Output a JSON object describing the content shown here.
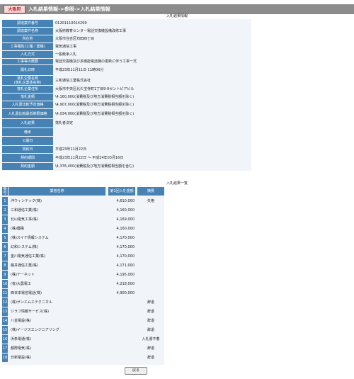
{
  "header": {
    "logo": "大阪府",
    "breadcrumb": "入札結果情報->参照->入札結果情報"
  },
  "detail": {
    "title": "入札結果情報",
    "rows": [
      {
        "label": [
          "調達案件番号"
        ],
        "value": [
          "01201110014299"
        ]
      },
      {
        "label": [
          "調達案件名称"
        ],
        "value": [
          "大阪府教育センター電話交換機設備改修工事"
        ]
      },
      {
        "label": [
          "所在地"
        ],
        "value": [
          "大阪市住吉区苅田四丁目"
        ]
      },
      {
        "label": [
          "工事種別(工種／業種)"
        ],
        "value": [
          "電気通信工事"
        ]
      },
      {
        "label": [
          "入札方式"
        ],
        "value": [
          "一般競争入札"
        ]
      },
      {
        "label": [
          "工事等の概要"
        ],
        "value": [
          "電話交換機及び多機能電話機の更新に伴う工事一式"
        ]
      },
      {
        "label": [
          "開札日時"
        ],
        "value": [
          "平成23年11月11日 11時00分"
        ]
      },
      {
        "label": [
          "落札企業名称",
          "(落札企業体名称)"
        ],
        "value": [
          "三和通信工業株式会社"
        ]
      },
      {
        "label": [
          "落札企業住所"
        ],
        "value": [
          "大阪市中央区北久宝寺町1丁目9-9セントピアビル"
        ]
      },
      {
        "label": [
          "落札金額"
        ],
        "value": [
          "\\4,160,000(消費税及び地方消費税相当額を除く)"
        ]
      },
      {
        "label": [
          "入札書比較予定価格"
        ],
        "value": [
          "\\4,907,000(消費税及び地方消費税相当額を除く)"
        ]
      },
      {
        "label": [
          "入札書比較最低制限価格"
        ],
        "value": [
          "\\4,034,000(消費税及び地方消費税相当額を除く)"
        ]
      },
      {
        "label": [
          "入札結果"
        ],
        "value": [
          "落札者決定"
        ]
      },
      {
        "label": [
          "備考"
        ],
        "value": [
          ""
        ]
      },
      {
        "label": [
          "公開日"
        ],
        "value": [
          ""
        ]
      },
      {
        "label": [
          "契約日"
        ],
        "value": [
          "平成23年11月22日"
        ]
      },
      {
        "label": [
          "契約期間"
        ],
        "value": [
          "平成23年11月22日 ～ 平成24年03月16日"
        ]
      },
      {
        "label": [
          "契約金額"
        ],
        "value": [
          "\\4,376,400(消費税及び地方消費税相当額を含む)"
        ]
      }
    ]
  },
  "bid_list": {
    "title": "入札結果一覧",
    "headers": [
      "番号",
      "業者名称",
      "第1回入札金額",
      "摘要"
    ],
    "rows": [
      {
        "no": "1",
        "name": "沖ウィンテック(株)",
        "amount": "4,610,000",
        "note": "失格"
      },
      {
        "no": "2",
        "name": "三和通信工業(株)",
        "amount": "4,160,000",
        "note": ""
      },
      {
        "no": "3",
        "name": "北山電気工事(株)",
        "amount": "4,169,000",
        "note": ""
      },
      {
        "no": "4",
        "name": "(株)優陽",
        "amount": "4,160,000",
        "note": ""
      },
      {
        "no": "5",
        "name": "(株)スイテ情報システム",
        "amount": "4,170,000",
        "note": ""
      },
      {
        "no": "6",
        "name": "幻和システム(株)",
        "amount": "4,170,000",
        "note": ""
      },
      {
        "no": "7",
        "name": "金川電気通信工業(株)",
        "amount": "4,170,000",
        "note": ""
      },
      {
        "no": "8",
        "name": "藤井通信工業(株)",
        "amount": "4,171,000",
        "note": ""
      },
      {
        "no": "9",
        "name": "(株)テーネット",
        "amount": "4,195,000",
        "note": ""
      },
      {
        "no": "10",
        "name": "(有)大農電工",
        "amount": "4,218,000",
        "note": ""
      },
      {
        "no": "11",
        "name": "西日本電信電話(株)",
        "amount": "4,900,000",
        "note": ""
      },
      {
        "no": "12",
        "name": "(株)サンエムエテクニカル",
        "amount": "",
        "note": "辞退"
      },
      {
        "no": "13",
        "name": "ジラフ情報サービス(株)",
        "amount": "",
        "note": "辞退"
      },
      {
        "no": "14",
        "name": "八並電設(株)",
        "amount": "",
        "note": "辞退"
      },
      {
        "no": "15",
        "name": "(株)イージスエンジニアリング",
        "amount": "",
        "note": "辞退"
      },
      {
        "no": "16",
        "name": "浜条電通(株)",
        "amount": "",
        "note": "入札書不着"
      },
      {
        "no": "17",
        "name": "都際電気(株)",
        "amount": "",
        "note": "辞退"
      },
      {
        "no": "18",
        "name": "日新電設(株)",
        "amount": "",
        "note": "辞退"
      }
    ]
  },
  "back_button": "戻る"
}
